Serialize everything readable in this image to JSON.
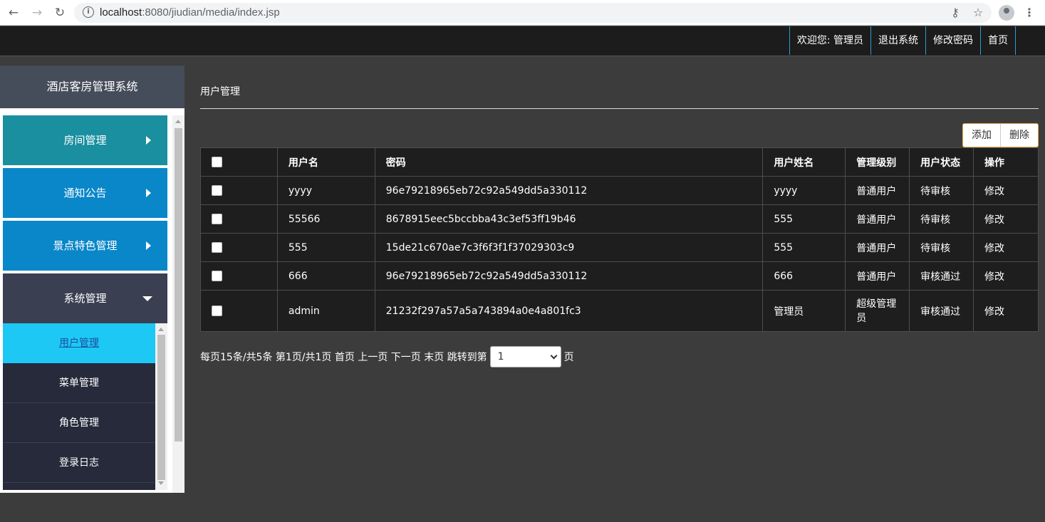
{
  "browser": {
    "url_host": "localhost",
    "url_rest": ":8080/jiudian/media/index.jsp"
  },
  "header": {
    "links": [
      "欢迎您: 管理员",
      "退出系统",
      "修改密码",
      "首页"
    ]
  },
  "sidebar": {
    "title": "酒店客房管理系统",
    "items": [
      {
        "label": "房间管理",
        "color": "#1a8fa0"
      },
      {
        "label": "通知公告",
        "color": "#0a87c9"
      },
      {
        "label": "景点特色管理",
        "color": "#0a87c9"
      },
      {
        "label": "系统管理",
        "color": "#3a3f52"
      }
    ],
    "submenu": [
      "用户管理",
      "菜单管理",
      "角色管理",
      "登录日志"
    ]
  },
  "main": {
    "title": "用户管理",
    "toolbar": {
      "add": "添加",
      "delete": "删除"
    },
    "columns": [
      "用户名",
      "密码",
      "用户姓名",
      "管理级别",
      "用户状态",
      "操作"
    ],
    "rows": [
      [
        "yyyy",
        "96e79218965eb72c92a549dd5a330112",
        "yyyy",
        "普通用户",
        "待审核",
        "修改"
      ],
      [
        "55566",
        "8678915eec5bccbba43c3ef53ff19b46",
        "555",
        "普通用户",
        "待审核",
        "修改"
      ],
      [
        "555",
        "15de21c670ae7c3f6f3f1f37029303c9",
        "555",
        "普通用户",
        "待审核",
        "修改"
      ],
      [
        "666",
        "96e79218965eb72c92a549dd5a330112",
        "666",
        "普通用户",
        "审核通过",
        "修改"
      ],
      [
        "admin",
        "21232f297a57a5a743894a0e4a801fc3",
        "管理员",
        "超级管理员",
        "审核通过",
        "修改"
      ]
    ],
    "pager": {
      "text": "每页15条/共5条 第1页/共1页 首页 上一页 下一页 末页 跳转到第",
      "selected": "1",
      "suffix": "页"
    }
  }
}
